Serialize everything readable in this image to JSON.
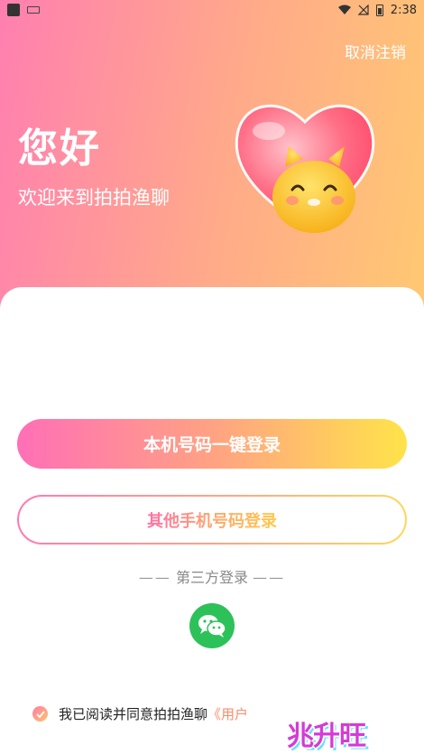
{
  "status_bar": {
    "time": "2:38"
  },
  "header": {
    "cancel_label": "取消注销",
    "title": "您好",
    "subtitle": "欢迎来到拍拍渔聊"
  },
  "login": {
    "primary_label": "本机号码一键登录",
    "secondary_label": "其他手机号码登录",
    "third_party_label": "第三方登录",
    "dash": "——"
  },
  "agreement": {
    "text": "我已阅读并同意拍拍渔聊",
    "link": "《用户"
  },
  "watermark": "兆升旺",
  "colors": {
    "accent_pink": "#ff6fb6",
    "accent_yellow": "#ffe34a",
    "wechat_green": "#2dc15a"
  }
}
